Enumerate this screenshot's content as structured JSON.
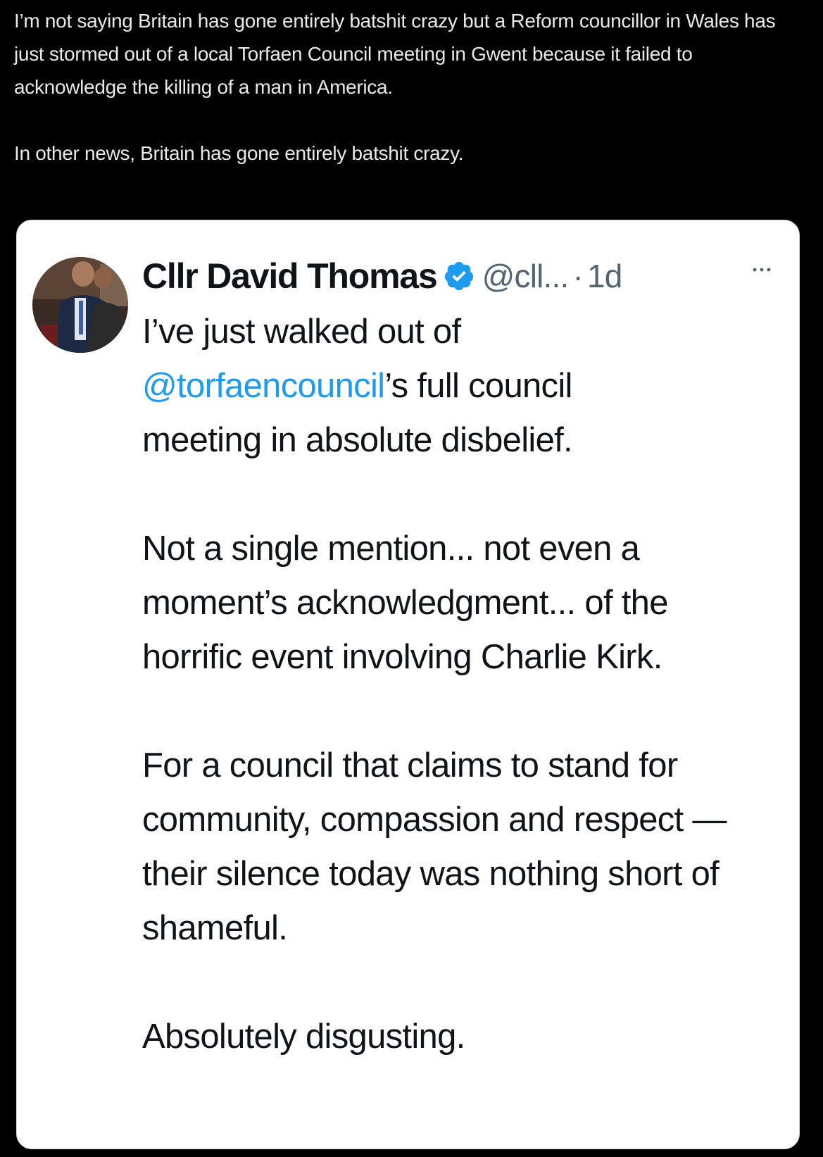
{
  "post": {
    "paragraph_1": "I’m not saying Britain has gone entirely batshit crazy but a Reform councillor in Wales has just stormed out of a local Torfaen Council meeting in Gwent because it failed to acknowledge the killing of a man in America.",
    "paragraph_2": "In other news, Britain has gone entirely batshit crazy."
  },
  "quote": {
    "author": "Cllr David Thomas",
    "handle": "@cll...",
    "separator": "·",
    "time": "1d",
    "body": {
      "line_1_pre": "I’ve just walked out of",
      "mention": "@torfaencouncil",
      "line_2_post": "’s full council",
      "line_3": "meeting in absolute disbelief.",
      "paragraph_2": "Not a single mention... not even a moment’s acknowledgment... of the horrific event involving Charlie Kirk.",
      "paragraph_3": "For a council that claims to stand for community, compassion and respect — their silence today was nothing short of shameful.",
      "paragraph_4": "Absolutely disgusting."
    }
  },
  "colors": {
    "page_background": "#000000",
    "top_text": "#e7e9ea",
    "card_background": "#ffffff",
    "card_text": "#0f1419",
    "secondary_text": "#536471",
    "link": "#1d9bf0",
    "verified_badge": "#1d9bf0"
  },
  "icons": {
    "verified": "verified-badge-icon",
    "more": "more-options-icon"
  }
}
